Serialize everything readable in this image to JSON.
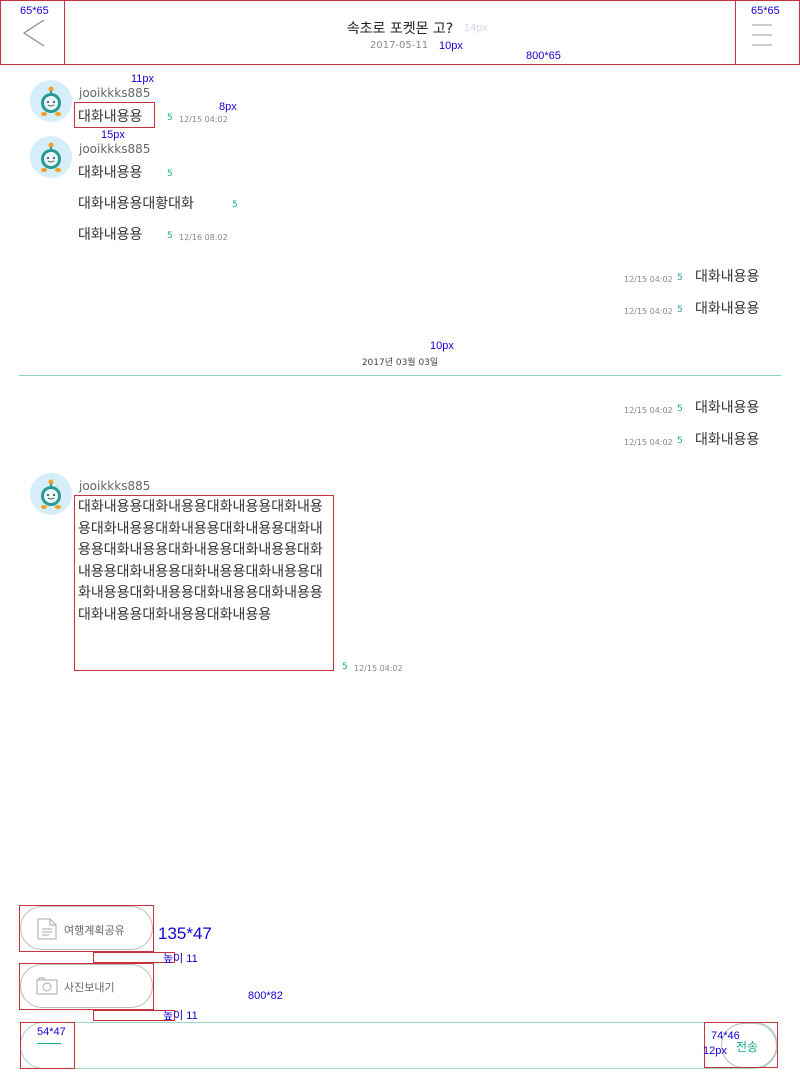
{
  "header": {
    "title": "속초로 포켓몬 고?",
    "date": "2017-05-11"
  },
  "messages_top": {
    "user": "jooikkks885",
    "first_msg": "대화내용용",
    "first_count": "5",
    "first_time": "12/15 04:02",
    "group_user": "jooikkks885",
    "group": [
      {
        "text": "대화내용용",
        "count": "5",
        "time": ""
      },
      {
        "text": "대화내용용대황대화",
        "count": "5",
        "time": ""
      },
      {
        "text": "대화내용용",
        "count": "5",
        "time": "12/16 08:02"
      }
    ]
  },
  "my_messages_1": [
    {
      "text": "대화내용용",
      "count": "5",
      "time": "12/15 04:02"
    },
    {
      "text": "대화내용용",
      "count": "5",
      "time": "12/15 04:02"
    }
  ],
  "date_divider": "2017년 03월 03일",
  "my_messages_2": [
    {
      "text": "대화내용용",
      "count": "5",
      "time": "12/15 04:02"
    },
    {
      "text": "대화내용용",
      "count": "5",
      "time": "12/15 04:02"
    }
  ],
  "long_message": {
    "user": "jooikkks885",
    "text": "대화내용용대화내용용대화내용용대화내용용대화내용용대화내용용대화내용용대화내용용대화내용용대화내용용대화내용용대화내용용대화내용용대화내용용대화내용용대화내용용대화내용용대화내용용대화내용용대화내용용대화내용용대화내용용",
    "count": "5",
    "time": "12/15 04:02"
  },
  "bottom": {
    "share_plan_label": "여행계획공유",
    "send_photo_label": "사진보내기",
    "send_label": "전송"
  },
  "annotations": {
    "a_header_left": "65*65",
    "a_header_right": "65*65",
    "a_title_size": "14px",
    "a_date_size": "10px",
    "a_header_dim": "800*65",
    "a_11px": "11px",
    "a_8px": "8px",
    "a_15px": "15px",
    "a_10px": "10px",
    "a_pill": "135*47",
    "a_gap1": "높이 11",
    "a_bottom_dim": "800*82",
    "a_gap2": "높이 11",
    "a_left_btn": "54*47",
    "a_send_btn": "74*46",
    "a_send_size": "12px"
  },
  "colors": {
    "accent": "#1aa88f",
    "spec_box": "#c8323c",
    "spec_text": "#1400d2"
  }
}
